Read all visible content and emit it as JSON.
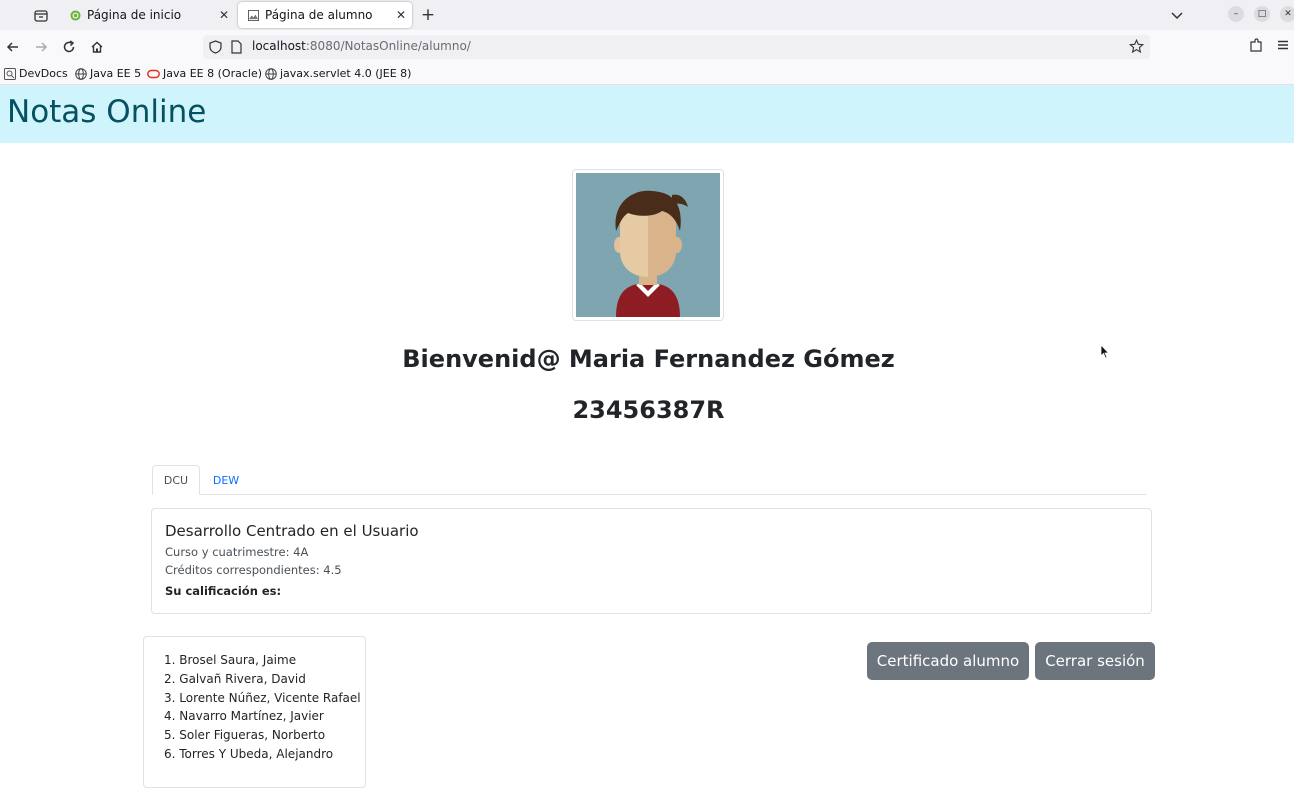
{
  "browser": {
    "tabs": [
      {
        "title": "Página de inicio",
        "active": false
      },
      {
        "title": "Página de alumno",
        "active": true
      }
    ],
    "url_host": "localhost",
    "url_rest": ":8080/NotasOnline/alumno/",
    "bookmarks": [
      "DevDocs",
      "Java EE 5",
      "Java EE 8 (Oracle)",
      "javax.servlet 4.0 (JEE 8)"
    ],
    "icons": {
      "tab_close": "✕",
      "new_tab": "+",
      "minimize": "–",
      "maximize": "□",
      "close": "✕"
    }
  },
  "page": {
    "site_title": "Notas Online",
    "welcome": "Bienvenid@ Maria Fernandez Gómez",
    "dni": "23456387R",
    "subject_tabs": [
      "DCU",
      "DEW"
    ],
    "active_tab": "DCU",
    "subject": {
      "name": "Desarrollo Centrado en el Usuario",
      "course_line": "Curso y cuatrimestre: 4A",
      "credits_line": "Créditos correspondientes: 4.5",
      "grade_label": "Su calificación es:"
    },
    "professors": [
      "Brosel Saura, Jaime",
      "Galvañ Rivera, David",
      "Lorente Núñez, Vicente Rafael",
      "Navarro Martínez, Javier",
      "Soler Figueras, Norberto",
      "Torres Y Ubeda, Alejandro"
    ],
    "buttons": {
      "certificate": "Certificado alumno",
      "logout": "Cerrar sesión"
    }
  },
  "colors": {
    "header_bg": "#cff4fc",
    "header_text": "#055160",
    "button_bg": "#6c757d",
    "link": "#0d6efd"
  }
}
